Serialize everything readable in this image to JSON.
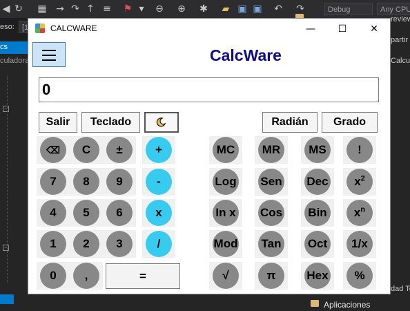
{
  "ide": {
    "toolbar_config": "Debug",
    "toolbar_platform": "Any CPU",
    "left_proceso": "eso:",
    "left_proceso_value": "[1",
    "left_tab": "cs",
    "left_file": "culadora",
    "right_preview": "review",
    "right_partial": "partir",
    "right_calcul": "Calcul",
    "right_bottom_text": "dad Te",
    "solution_folder": "Aplicaciones"
  },
  "window": {
    "title": "CALCWARE",
    "minimize_glyph": "—",
    "maximize_glyph": "☐",
    "close_glyph": "✕"
  },
  "app": {
    "name": "CalcWare",
    "display": "0"
  },
  "toolbar": {
    "exit": "Salir",
    "keyboard": "Teclado",
    "radian": "Radián",
    "degree": "Grado"
  },
  "keypad": {
    "backspace": "⌫",
    "clear": "C",
    "plusminus": "±",
    "plus": "+",
    "n7": "7",
    "n8": "8",
    "n9": "9",
    "minus": "-",
    "n4": "4",
    "n5": "5",
    "n6": "6",
    "times": "x",
    "n1": "1",
    "n2": "2",
    "n3": "3",
    "divide": "/",
    "n0": "0",
    "comma": ",",
    "equals": "="
  },
  "scientific": {
    "mc": "MC",
    "mr": "MR",
    "ms": "MS",
    "fact": "!",
    "log": "Log",
    "sen": "Sen",
    "dec": "Dec",
    "sq_base": "x",
    "sq_exp": "2",
    "ln": "In x",
    "cos": "Cos",
    "bin": "Bin",
    "pow_base": "x",
    "pow_exp": "n",
    "mod": "Mod",
    "tan": "Tan",
    "oct": "Oct",
    "inv": "1/x",
    "sqrt": "√",
    "pi": "π",
    "hex": "Hex",
    "percent": "%"
  },
  "colors": {
    "title_blue": "#0d0d8c",
    "operator_cyan": "#38cbf0",
    "digit_gray": "#888888",
    "menu_blue": "#cce4f7"
  }
}
